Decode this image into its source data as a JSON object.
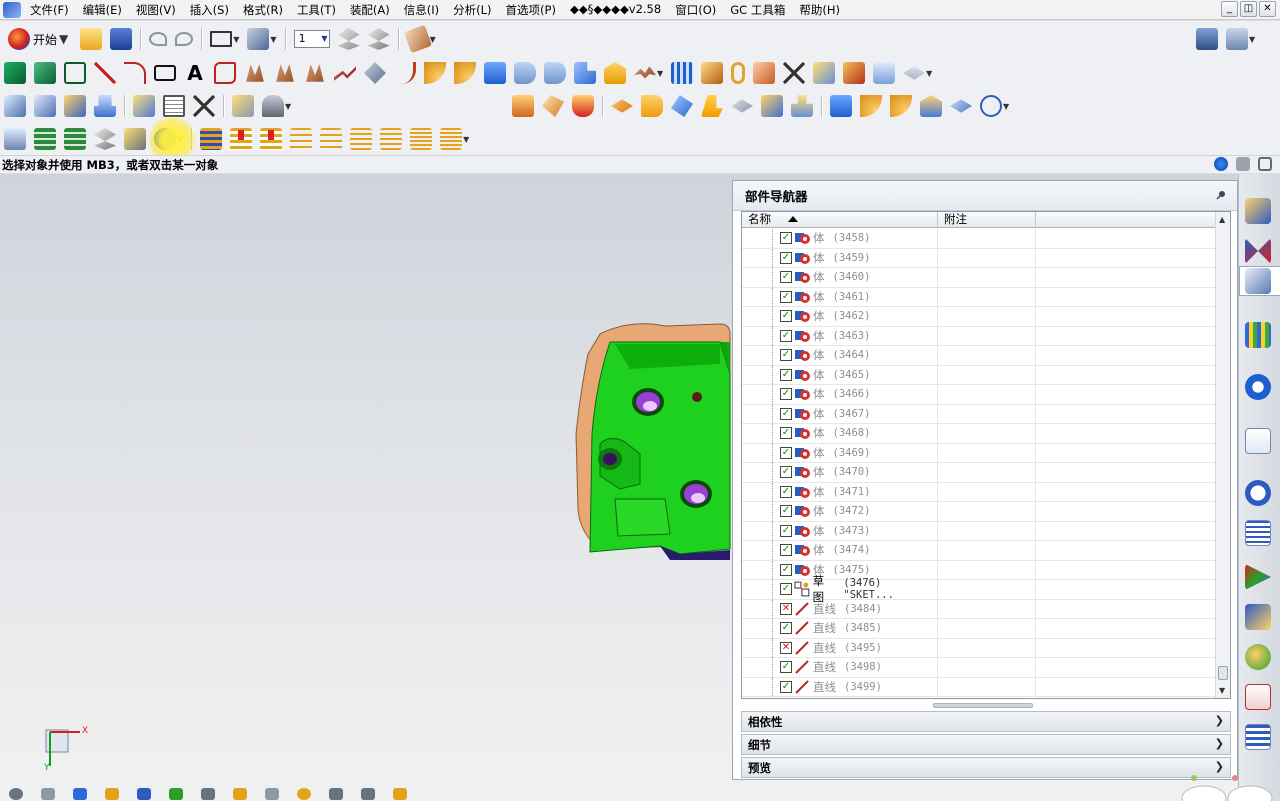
{
  "menu": {
    "items": [
      "文件(F)",
      "编辑(E)",
      "视图(V)",
      "插入(S)",
      "格式(R)",
      "工具(T)",
      "装配(A)",
      "信息(I)",
      "分析(L)",
      "首选项(P)",
      "◆◆§◆◆◆◆v2.58",
      "窗口(O)",
      "GC 工具箱",
      "帮助(H)"
    ],
    "win_min": "_",
    "win_restore": "◫",
    "win_close": "✕"
  },
  "toolbar": {
    "start_label": "开始",
    "layer_value": "1"
  },
  "cue": {
    "text": "选择对象并使用 MB3，或者双击某一对象"
  },
  "navigator": {
    "title": "部件导航器",
    "columns": {
      "name": "名称",
      "note": "附注"
    },
    "rows": [
      {
        "check": "on",
        "type": "体",
        "id": "(3458)",
        "icon": "body-icon",
        "dark": false
      },
      {
        "check": "on",
        "type": "体",
        "id": "(3459)",
        "icon": "body-icon",
        "dark": false
      },
      {
        "check": "on",
        "type": "体",
        "id": "(3460)",
        "icon": "body-icon",
        "dark": false
      },
      {
        "check": "on",
        "type": "体",
        "id": "(3461)",
        "icon": "body-icon",
        "dark": false
      },
      {
        "check": "on",
        "type": "体",
        "id": "(3462)",
        "icon": "body-icon",
        "dark": false
      },
      {
        "check": "on",
        "type": "体",
        "id": "(3463)",
        "icon": "body-icon",
        "dark": false
      },
      {
        "check": "on",
        "type": "体",
        "id": "(3464)",
        "icon": "body-icon",
        "dark": false
      },
      {
        "check": "on",
        "type": "体",
        "id": "(3465)",
        "icon": "body-icon",
        "dark": false
      },
      {
        "check": "on",
        "type": "体",
        "id": "(3466)",
        "icon": "body-icon",
        "dark": false
      },
      {
        "check": "on",
        "type": "体",
        "id": "(3467)",
        "icon": "body-icon",
        "dark": false
      },
      {
        "check": "on",
        "type": "体",
        "id": "(3468)",
        "icon": "body-icon",
        "dark": false
      },
      {
        "check": "on",
        "type": "体",
        "id": "(3469)",
        "icon": "body-icon",
        "dark": false
      },
      {
        "check": "on",
        "type": "体",
        "id": "(3470)",
        "icon": "body-icon",
        "dark": false
      },
      {
        "check": "on",
        "type": "体",
        "id": "(3471)",
        "icon": "body-icon",
        "dark": false
      },
      {
        "check": "on",
        "type": "体",
        "id": "(3472)",
        "icon": "body-icon",
        "dark": false
      },
      {
        "check": "on",
        "type": "体",
        "id": "(3473)",
        "icon": "body-icon",
        "dark": false
      },
      {
        "check": "on",
        "type": "体",
        "id": "(3474)",
        "icon": "body-icon",
        "dark": false
      },
      {
        "check": "on",
        "type": "体",
        "id": "(3475)",
        "icon": "body-icon",
        "dark": false
      },
      {
        "check": "on",
        "type": "草图",
        "id": "(3476) \"SKET...",
        "icon": "sketch-icon",
        "dark": true
      },
      {
        "check": "off",
        "type": "直线",
        "id": "(3484)",
        "icon": "line-icon",
        "dark": false
      },
      {
        "check": "on",
        "type": "直线",
        "id": "(3485)",
        "icon": "line-icon",
        "dark": false
      },
      {
        "check": "off",
        "type": "直线",
        "id": "(3495)",
        "icon": "line-icon",
        "dark": false
      },
      {
        "check": "on",
        "type": "直线",
        "id": "(3498)",
        "icon": "line-icon",
        "dark": false
      },
      {
        "check": "on",
        "type": "直线",
        "id": "(3499)",
        "icon": "line-icon",
        "dark": false
      }
    ],
    "sections": [
      "相依性",
      "细节",
      "预览"
    ]
  },
  "triad": {
    "x": "X",
    "y": "Y"
  },
  "colors": {
    "model_green": "#1fd11f",
    "model_copper": "#e8a876",
    "hole_purple": "#9a3fd6",
    "check_green": "#0a8a12",
    "check_red": "#d21b1b"
  }
}
